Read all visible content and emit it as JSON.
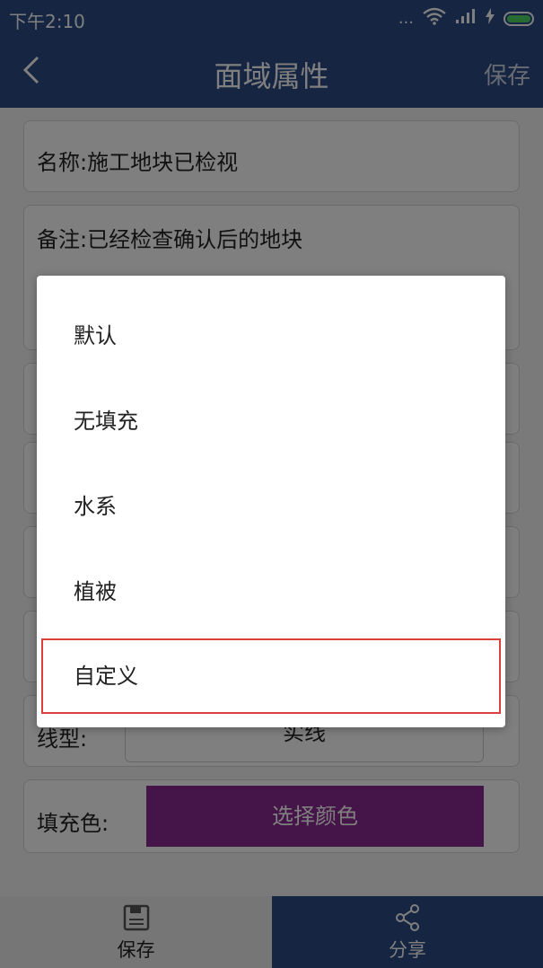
{
  "status_bar": {
    "time": "下午2:10",
    "signal_dots": "..."
  },
  "header": {
    "title": "面域属性",
    "save_label": "保存"
  },
  "form": {
    "name_label": "名称:",
    "name_value": "施工地块已检视",
    "note_label": "备注:",
    "note_value": "已经检查确认后的地块",
    "line_type_label": "线型:",
    "line_type_value": "实线",
    "fill_color_label": "填充色:",
    "fill_color_button": "选择颜色",
    "fill_color_hex": "#8a2a93"
  },
  "dialog": {
    "options": [
      "默认",
      "无填充",
      "水系",
      "植被",
      "自定义"
    ],
    "highlighted_option": "自定义"
  },
  "bottom_bar": {
    "save_label": "保存",
    "share_label": "分享"
  },
  "colors": {
    "primary": "#2a4a85",
    "highlight_border": "#d9413e"
  }
}
